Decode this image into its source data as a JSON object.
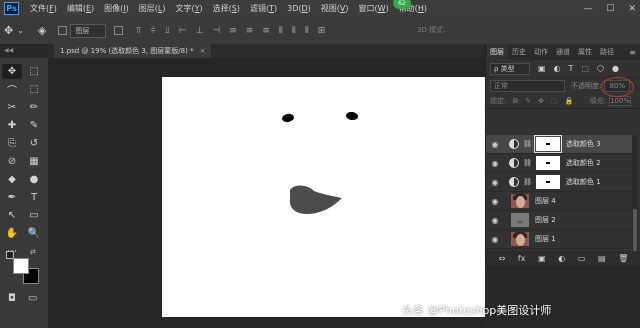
{
  "app": {
    "logo": "Ps"
  },
  "menu": {
    "items": [
      {
        "label": "文件(",
        "acc": "F",
        "tail": ")"
      },
      {
        "label": "编辑(",
        "acc": "E",
        "tail": ")"
      },
      {
        "label": "图像(",
        "acc": "I",
        "tail": ")"
      },
      {
        "label": "图层(",
        "acc": "L",
        "tail": ")"
      },
      {
        "label": "文字(",
        "acc": "Y",
        "tail": ")"
      },
      {
        "label": "选择(",
        "acc": "S",
        "tail": ")"
      },
      {
        "label": "滤镜(",
        "acc": "T",
        "tail": ")"
      },
      {
        "label": "3D(",
        "acc": "D",
        "tail": ")"
      },
      {
        "label": "视图(",
        "acc": "V",
        "tail": ")"
      },
      {
        "label": "窗口(",
        "acc": "W",
        "tail": ")"
      },
      {
        "label": "帮助(",
        "acc": "H",
        "tail": ")"
      }
    ],
    "badge": "62"
  },
  "window": {
    "minimize": "—",
    "maximize": "☐",
    "close": "✕"
  },
  "options": {
    "move_icon": "✥",
    "dropdown_icon": "⌄",
    "layer_select": "图层",
    "mode3d": "3D 模式:"
  },
  "document": {
    "tab_title": "1.psd @ 19% (选取颜色 3, 图层蒙版/8) *",
    "tab_close": "×",
    "collapse": "◀◀"
  },
  "tools": {
    "items": [
      "✥",
      "⬚",
      "⌒",
      "⬚",
      "✂",
      "✏",
      "✚",
      "✎",
      "⊘",
      "▦",
      "◆",
      "●",
      "✒",
      "T",
      "↖",
      "▭",
      "✋",
      "🔍",
      "⋯",
      ""
    ],
    "quickmask": "◘",
    "screenmode": "▭"
  },
  "panel": {
    "tabs": [
      "图层",
      "历史",
      "动作",
      "通道",
      "属性",
      "路径"
    ],
    "active_tab": "图层",
    "menu_icon": "≡",
    "kind": "ρ 类型",
    "filter_icons": [
      "▣",
      "◐",
      "T",
      "⬚",
      "⬡",
      "●"
    ],
    "blend_mode": "正常",
    "opacity_label": "不透明度:",
    "opacity_value": "80%",
    "lock_label": "锁定:",
    "lock_icons": [
      "⊠",
      "✎",
      "✥",
      "⬚",
      "🔒"
    ],
    "fill_label": "填充:",
    "fill_value": "100%",
    "layers": [
      {
        "name": "选取颜色 3",
        "type": "adjustment",
        "selected": true
      },
      {
        "name": "选取颜色 2",
        "type": "adjustment",
        "selected": false
      },
      {
        "name": "选取颜色 1",
        "type": "adjustment",
        "selected": false
      },
      {
        "name": "图层 4",
        "type": "photo",
        "selected": false
      },
      {
        "name": "图层 2",
        "type": "gray",
        "selected": false
      },
      {
        "name": "图层 1",
        "type": "photo",
        "selected": false
      }
    ],
    "footer_icons": [
      "⇔",
      "fx",
      "▣",
      "◐",
      "▭",
      "▤",
      "🗑"
    ]
  },
  "watermark": "头条 @Photoshop美图设计师"
}
